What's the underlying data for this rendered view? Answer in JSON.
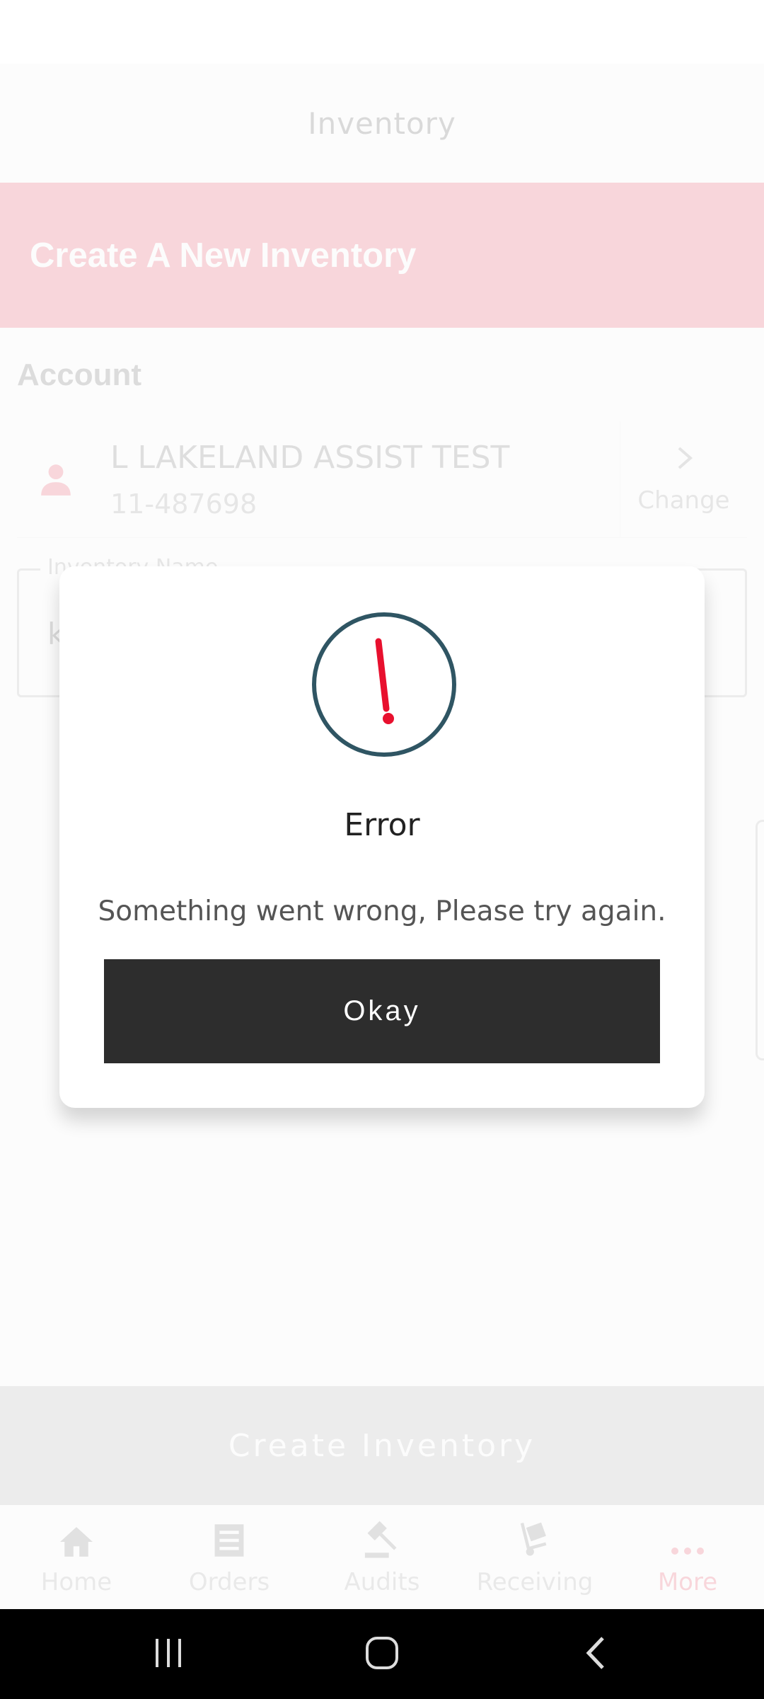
{
  "header": {
    "title": "Inventory"
  },
  "banner": {
    "title": "Create A New Inventory"
  },
  "account": {
    "section_label": "Account",
    "name": "L LAKELAND ASSIST TEST",
    "number": "11-487698",
    "change_label": "Change"
  },
  "inventory_name_field": {
    "label": "Inventory Name",
    "value": "k"
  },
  "primary_action": {
    "label": "Create Inventory"
  },
  "tabs": [
    {
      "label": "Home",
      "icon": "home-icon"
    },
    {
      "label": "Orders",
      "icon": "orders-icon"
    },
    {
      "label": "Audits",
      "icon": "gavel-icon"
    },
    {
      "label": "Receiving",
      "icon": "hand-truck-icon"
    },
    {
      "label": "More",
      "icon": "more-dots-icon",
      "active": true
    }
  ],
  "dialog": {
    "icon": "alert-exclamation-icon",
    "title": "Error",
    "message": "Something went wrong, Please try again.",
    "button_label": "Okay"
  },
  "colors": {
    "brand_red": "#e8102e",
    "dialog_ring": "#2f5563",
    "dialog_button": "#2d2d2d"
  }
}
